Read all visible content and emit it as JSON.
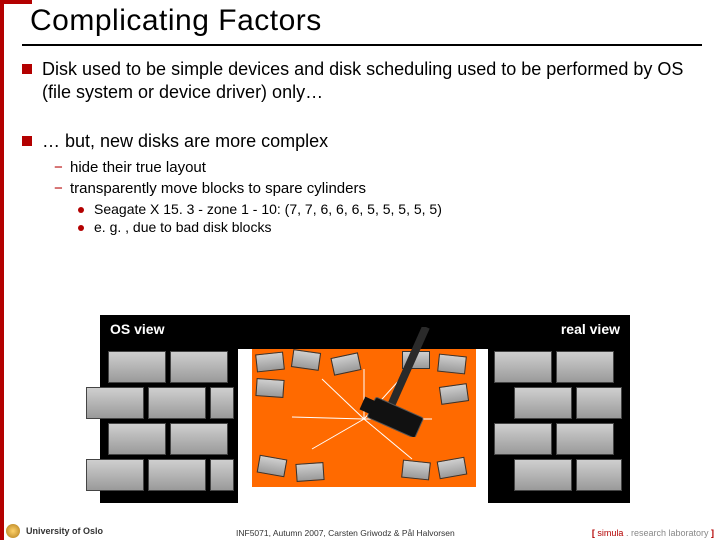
{
  "title": "Complicating Factors",
  "bullets": [
    "Disk used to be simple devices and disk scheduling used to be performed by OS (file system or device driver) only…",
    "… but, new disks are more complex"
  ],
  "subs": [
    "hide their true layout",
    "transparently move blocks to spare cylinders"
  ],
  "subsubs": [
    "Seagate X 15. 3 - zone 1 - 10: (7, 7, 6, 6, 6, 5, 5, 5, 5, 5)",
    "e. g. , due to bad disk blocks"
  ],
  "figure": {
    "os_label": "OS view",
    "real_label": "real view"
  },
  "footer": {
    "university": "University of Oslo",
    "course": "INF5071, Autumn 2007, Carsten Griwodz & Pål Halvorsen",
    "lab_bracket_open": "[ ",
    "lab_simula": "simula",
    "lab_dot": " . ",
    "lab_research": "research laboratory",
    "lab_bracket_close": " ]"
  }
}
